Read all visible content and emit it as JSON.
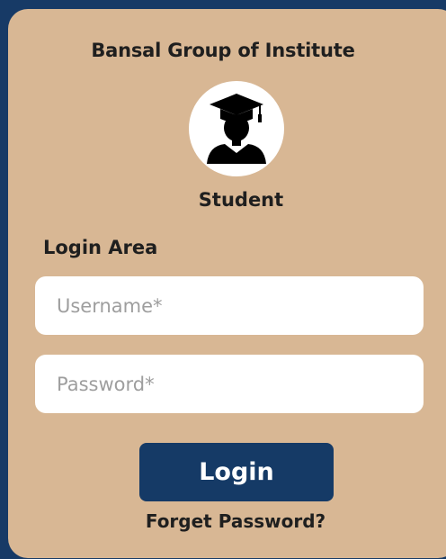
{
  "header": {
    "institute": "Bansal Group of Institute"
  },
  "profile": {
    "icon": "graduate-student-icon",
    "role": "Student"
  },
  "login": {
    "section_title": "Login Area",
    "username_placeholder": "Username*",
    "password_placeholder": "Password*",
    "submit_label": "Login",
    "forgot_label": "Forget Password?"
  },
  "colors": {
    "background": "#173a66",
    "card": "#d8b794",
    "button": "#153a66",
    "text": "#1f1f1f"
  }
}
